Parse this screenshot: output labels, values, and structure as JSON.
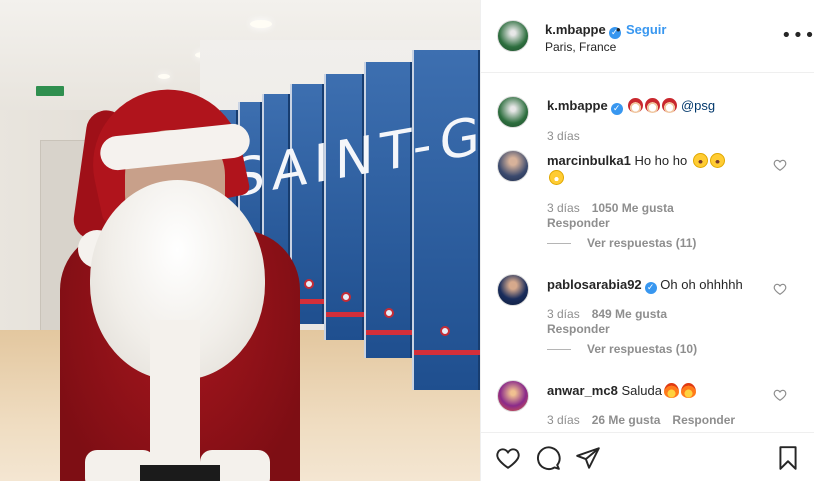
{
  "photo": {
    "wall_text": "SAINT-GEN"
  },
  "header": {
    "username": "k.mbappe",
    "verified": true,
    "follow_label": "Seguir",
    "separator": "•",
    "location": "Paris, France",
    "more_label": "•••"
  },
  "caption": {
    "username": "k.mbappe",
    "emojis": [
      "santa-emoji",
      "santa-emoji",
      "santa-emoji"
    ],
    "mention": "@psg",
    "time": "3 días"
  },
  "comments": [
    {
      "username": "marcinbulka1",
      "verified": false,
      "text": "Ho ho ho",
      "emojis": [
        "laughing-emoji",
        "laughing-emoji",
        "grinning-emoji"
      ],
      "time": "3 días",
      "likes": "1050 Me gusta",
      "reply_label": "Responder",
      "view_replies": "Ver respuestas (11)"
    },
    {
      "username": "pablosarabia92",
      "verified": true,
      "text": "Oh oh ohhhhh",
      "time": "3 días",
      "likes": "849 Me gusta",
      "reply_label": "Responder",
      "view_replies": "Ver respuestas (10)"
    },
    {
      "username": "anwar_mc8",
      "verified": false,
      "text": "Saluda",
      "emojis": [
        "fire-emoji",
        "fire-emoji"
      ],
      "time": "3 días",
      "likes": "26 Me gusta",
      "reply_label": "Responder"
    }
  ],
  "colors": {
    "accent": "#3897f0",
    "text": "#262626",
    "muted": "#8e8e8e",
    "mention": "#00376b"
  },
  "icons": [
    "heart-icon",
    "comment-icon",
    "share-icon",
    "bookmark-icon",
    "verified-icon",
    "more-icon"
  ]
}
